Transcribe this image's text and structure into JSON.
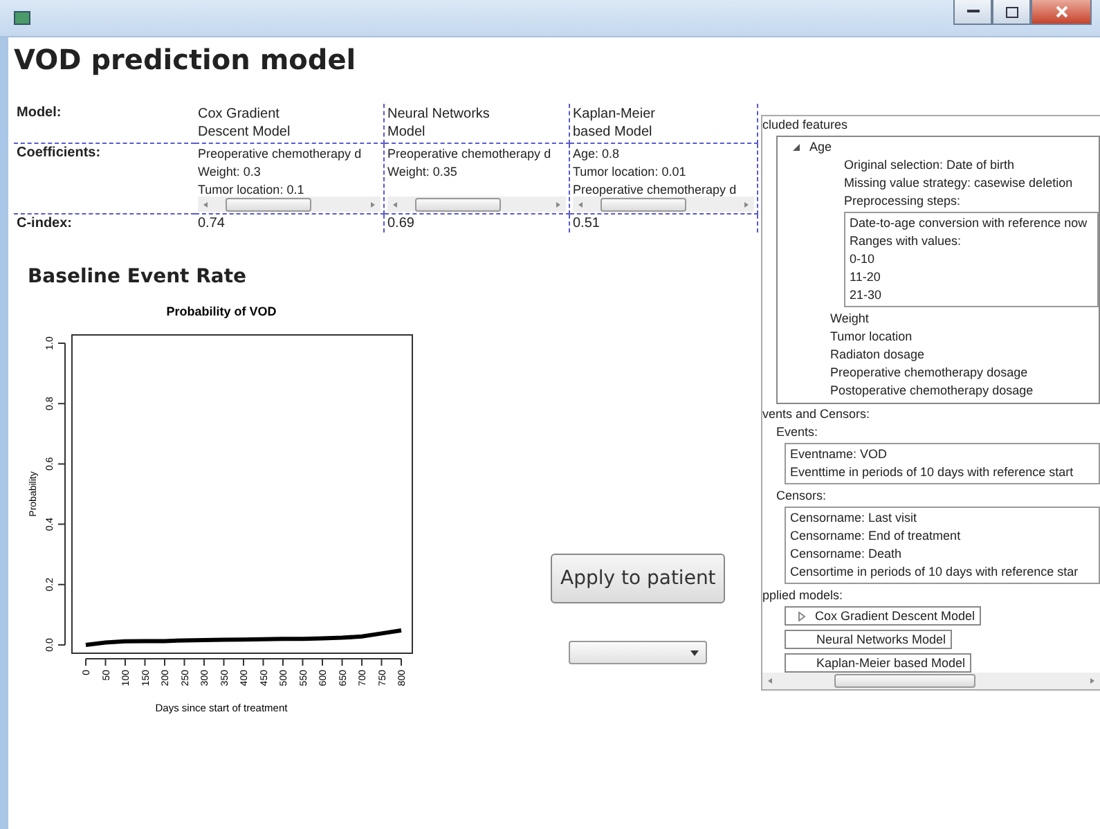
{
  "heading": "VOD prediction model",
  "models_table": {
    "row_labels": [
      "Model:",
      "Coefficients:",
      "C-index:"
    ],
    "models": [
      {
        "name_lines": [
          "Cox Gradient",
          "Descent Model"
        ],
        "coefficients": [
          "Preoperative chemotherapy d",
          "Weight: 0.3",
          "Tumor location: 0.1"
        ],
        "c_index": "0.74"
      },
      {
        "name_lines": [
          "Neural Networks",
          "Model"
        ],
        "coefficients": [
          "Preoperative chemotherapy d",
          "Weight: 0.35"
        ],
        "c_index": "0.69"
      },
      {
        "name_lines": [
          "Kaplan-Meier",
          "based Model"
        ],
        "coefficients": [
          "Age: 0.8",
          "Tumor location: 0.01",
          "Preoperative chemotherapy d"
        ],
        "c_index": "0.51"
      }
    ]
  },
  "baseline": {
    "title": "Baseline Event Rate",
    "chart_data": {
      "type": "line",
      "title": "Probability of VOD",
      "xlabel": "Days since start of treatment",
      "ylabel": "Probability",
      "x": [
        0,
        50,
        100,
        150,
        200,
        250,
        300,
        350,
        400,
        450,
        500,
        550,
        600,
        650,
        700,
        750,
        800
      ],
      "series": [
        {
          "color": "#000000",
          "values": [
            0,
            0.008,
            0.012,
            0.013,
            0.013,
            0.015,
            0.016,
            0.017,
            0.018,
            0.019,
            0.02,
            0.02,
            0.022,
            0.024,
            0.028,
            0.038,
            0.048
          ]
        }
      ],
      "xlim": [
        0,
        800
      ],
      "ylim": [
        0,
        1
      ],
      "xticks": [
        0,
        50,
        100,
        150,
        200,
        250,
        300,
        350,
        400,
        450,
        500,
        550,
        600,
        650,
        700,
        750,
        800
      ],
      "yticks": [
        {
          "value": 0,
          "label": "0.0"
        },
        {
          "value": 0.2,
          "label": "0.2"
        },
        {
          "value": 0.4,
          "label": "0.4"
        },
        {
          "value": 0.6,
          "label": "0.6"
        },
        {
          "value": 0.8,
          "label": "0.8"
        },
        {
          "value": 1,
          "label": "1.0"
        }
      ]
    }
  },
  "apply_button": "Apply to patient",
  "details": {
    "included_features": {
      "label": "cluded features",
      "items": [
        {
          "label": "Age",
          "expanded": true,
          "details": [
            "Original selection: Date of birth",
            "Missing value strategy: casewise deletion",
            "Preprocessing steps:"
          ],
          "preprocessing": [
            "Date-to-age conversion with reference now",
            "Ranges with values:",
            "0-10",
            "11-20",
            "21-30"
          ]
        },
        {
          "label": "Weight"
        },
        {
          "label": "Tumor location"
        },
        {
          "label": "Radiaton dosage"
        },
        {
          "label": "Preoperative chemotherapy dosage"
        },
        {
          "label": "Postoperative chemotherapy dosage"
        }
      ]
    },
    "events_and_censors": {
      "label": "vents and Censors:",
      "events_label": "Events:",
      "events": [
        "Eventname: VOD",
        "Eventtime in periods of 10 days with reference start"
      ],
      "censors_label": "Censors:",
      "censors": [
        "Censorname: Last visit",
        "Censorname: End of treatment",
        "Censorname: Death",
        "Censortime in periods of 10 days with reference star"
      ]
    },
    "applied_models": {
      "label": "pplied models:",
      "items": [
        {
          "label": "Cox Gradient Descent Model",
          "expanded": false
        },
        {
          "label": "Neural Networks Model"
        },
        {
          "label": "Kaplan-Meier based Model"
        }
      ]
    }
  }
}
